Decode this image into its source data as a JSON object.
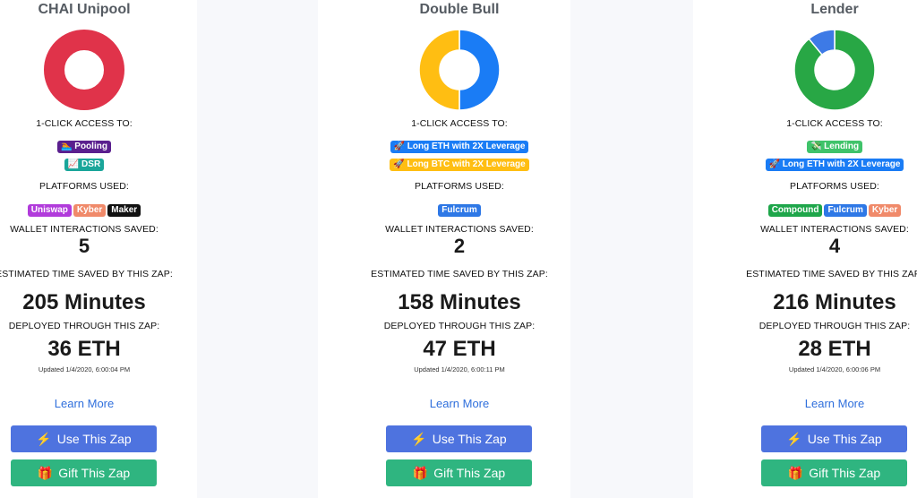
{
  "cards": [
    {
      "title": "CHAI Unipool",
      "donut": {
        "fractions": [
          1.0
        ],
        "colors": [
          "#e0334a"
        ]
      },
      "access_label": "1-CLICK ACCESS TO:",
      "access": [
        {
          "icon": "pooling-icon",
          "glyph": "🏊",
          "text": "Pooling",
          "color": "#5a1f8e"
        },
        {
          "icon": "dsr-icon",
          "glyph": "📈",
          "text": "DSR",
          "color": "#1aa69a"
        }
      ],
      "platforms_label": "PLATFORMS USED:",
      "platforms": [
        {
          "text": "Uniswap",
          "color": "#b13bdb"
        },
        {
          "text": "Kyber",
          "color": "#f08a6a"
        },
        {
          "text": "Maker",
          "color": "#111111"
        }
      ],
      "wallet_label": "WALLET INTERACTIONS SAVED:",
      "wallet_value": "5",
      "time_label": "ESTIMATED TIME SAVED BY THIS ZAP:",
      "time_value": "205 Minutes",
      "deployed_label": "DEPLOYED THROUGH THIS ZAP:",
      "deployed_value": "36 ETH",
      "updated": "Updated 1/4/2020, 6:00:04 PM",
      "learn_more": "Learn More",
      "use_label": "Use This Zap",
      "gift_label": "Gift This Zap"
    },
    {
      "title": "Double Bull",
      "donut": {
        "fractions": [
          0.5,
          0.5
        ],
        "colors": [
          "#1a7cf5",
          "#ffbe12"
        ]
      },
      "access_label": "1-CLICK ACCESS TO:",
      "access": [
        {
          "icon": "rocket-icon",
          "glyph": "🚀",
          "text": "Long ETH with 2X Leverage",
          "color": "#1a7cf5"
        },
        {
          "icon": "rocket-icon",
          "glyph": "🚀",
          "text": "Long BTC with 2X Leverage",
          "color": "#ffbe12"
        }
      ],
      "platforms_label": "PLATFORMS USED:",
      "platforms": [
        {
          "text": "Fulcrum",
          "color": "#2e78e6"
        }
      ],
      "wallet_label": "WALLET INTERACTIONS SAVED:",
      "wallet_value": "2",
      "time_label": "ESTIMATED TIME SAVED BY THIS ZAP:",
      "time_value": "158 Minutes",
      "deployed_label": "DEPLOYED THROUGH THIS ZAP:",
      "deployed_value": "47 ETH",
      "updated": "Updated 1/4/2020, 6:00:11 PM",
      "learn_more": "Learn More",
      "use_label": "Use This Zap",
      "gift_label": "Gift This Zap"
    },
    {
      "title": "Lender",
      "donut": {
        "fractions": [
          0.89,
          0.11
        ],
        "colors": [
          "#28a745",
          "#3d7ae6"
        ]
      },
      "access_label": "1-CLICK ACCESS TO:",
      "access": [
        {
          "icon": "lending-icon",
          "glyph": "💸",
          "text": "Lending",
          "color": "#3fc36a"
        },
        {
          "icon": "rocket-icon",
          "glyph": "🚀",
          "text": "Long ETH with 2X Leverage",
          "color": "#1a7cf5"
        }
      ],
      "platforms_label": "PLATFORMS USED:",
      "platforms": [
        {
          "text": "Compound",
          "color": "#1ea64a"
        },
        {
          "text": "Fulcrum",
          "color": "#2e78e6"
        },
        {
          "text": "Kyber",
          "color": "#f08a6a"
        }
      ],
      "wallet_label": "WALLET INTERACTIONS SAVED:",
      "wallet_value": "4",
      "time_label": "ESTIMATED TIME SAVED BY THIS ZAP:",
      "time_value": "216 Minutes",
      "deployed_label": "DEPLOYED THROUGH THIS ZAP:",
      "deployed_value": "28 ETH",
      "updated": "Updated 1/4/2020, 6:00:06 PM",
      "learn_more": "Learn More",
      "use_label": "Use This Zap",
      "gift_label": "Gift This Zap"
    }
  ]
}
